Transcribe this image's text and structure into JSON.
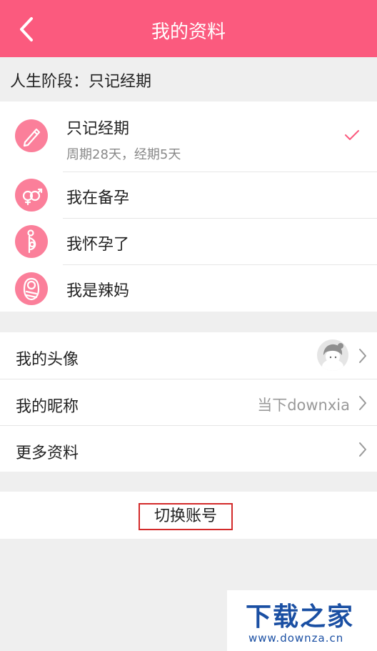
{
  "header": {
    "title": "我的资料",
    "back_icon": "chevron-left-icon"
  },
  "section_label": "人生阶段：只记经期",
  "stages": [
    {
      "name": "只记经期",
      "sub": "周期28天，经期5天",
      "icon": "pen-icon",
      "selected": true
    },
    {
      "name": "我在备孕",
      "icon": "gender-symbols-icon",
      "selected": false
    },
    {
      "name": "我怀孕了",
      "icon": "pregnant-icon",
      "selected": false
    },
    {
      "name": "我是辣妈",
      "icon": "baby-icon",
      "selected": false
    }
  ],
  "profile": {
    "avatar_label": "我的头像",
    "nickname_label": "我的昵称",
    "nickname_value": "当下downxia",
    "more_label": "更多资料"
  },
  "switch_account": "切换账号",
  "watermark": {
    "title": "下载之家",
    "url": "www.downza.cn"
  },
  "colors": {
    "accent": "#fb5a7e",
    "icon_bg": "#fb7f9a",
    "highlight_border": "#d32a2a",
    "watermark": "#1a4fa3"
  }
}
